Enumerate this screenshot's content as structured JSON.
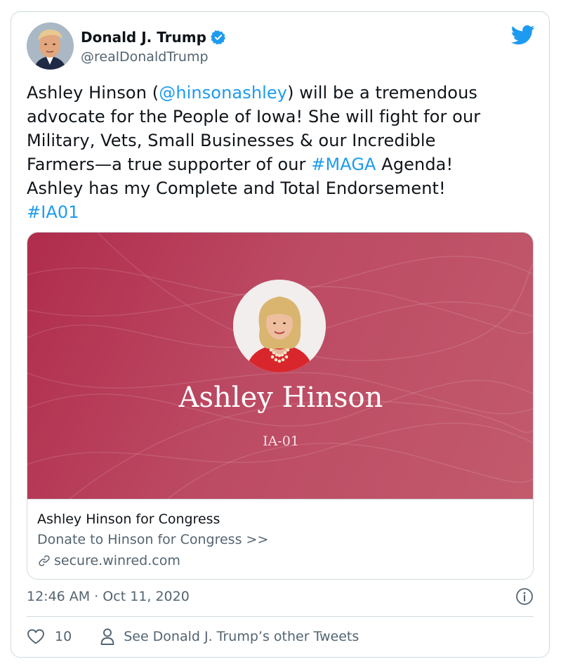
{
  "author": {
    "name": "Donald J. Trump",
    "handle": "@realDonaldTrump"
  },
  "tweet": {
    "line1_a": "Ashley Hinson (",
    "mention": "@hinsonashley",
    "line1_b": ") will be a tremendous",
    "line2": "advocate for the People of Iowa! She will fight for our",
    "line3": "Military, Vets, Small Businesses & our Incredible",
    "line4_a": "Farmers—a true supporter of our ",
    "hashtag1": "#MAGA",
    "line4_b": " Agenda!",
    "line5": "Ashley has my Complete and Total Endorsement!",
    "hashtag2": "#IA01"
  },
  "card": {
    "image_name": "Ashley Hinson",
    "image_district": "IA-01",
    "title": "Ashley Hinson for Congress",
    "description": "Donate to Hinson for Congress >>",
    "domain": "secure.winred.com"
  },
  "timestamp": "12:46 AM · Oct 11, 2020",
  "footer": {
    "like_count": "10",
    "other_tweets_label": "See Donald J. Trump’s other Tweets"
  },
  "colors": {
    "link_blue": "#1d9bf0",
    "card_red": "#b02c4c",
    "muted_text": "#536471"
  },
  "icons": [
    "twitter-bird-icon",
    "verified-badge-icon",
    "link-icon",
    "info-icon",
    "heart-icon",
    "person-icon"
  ]
}
